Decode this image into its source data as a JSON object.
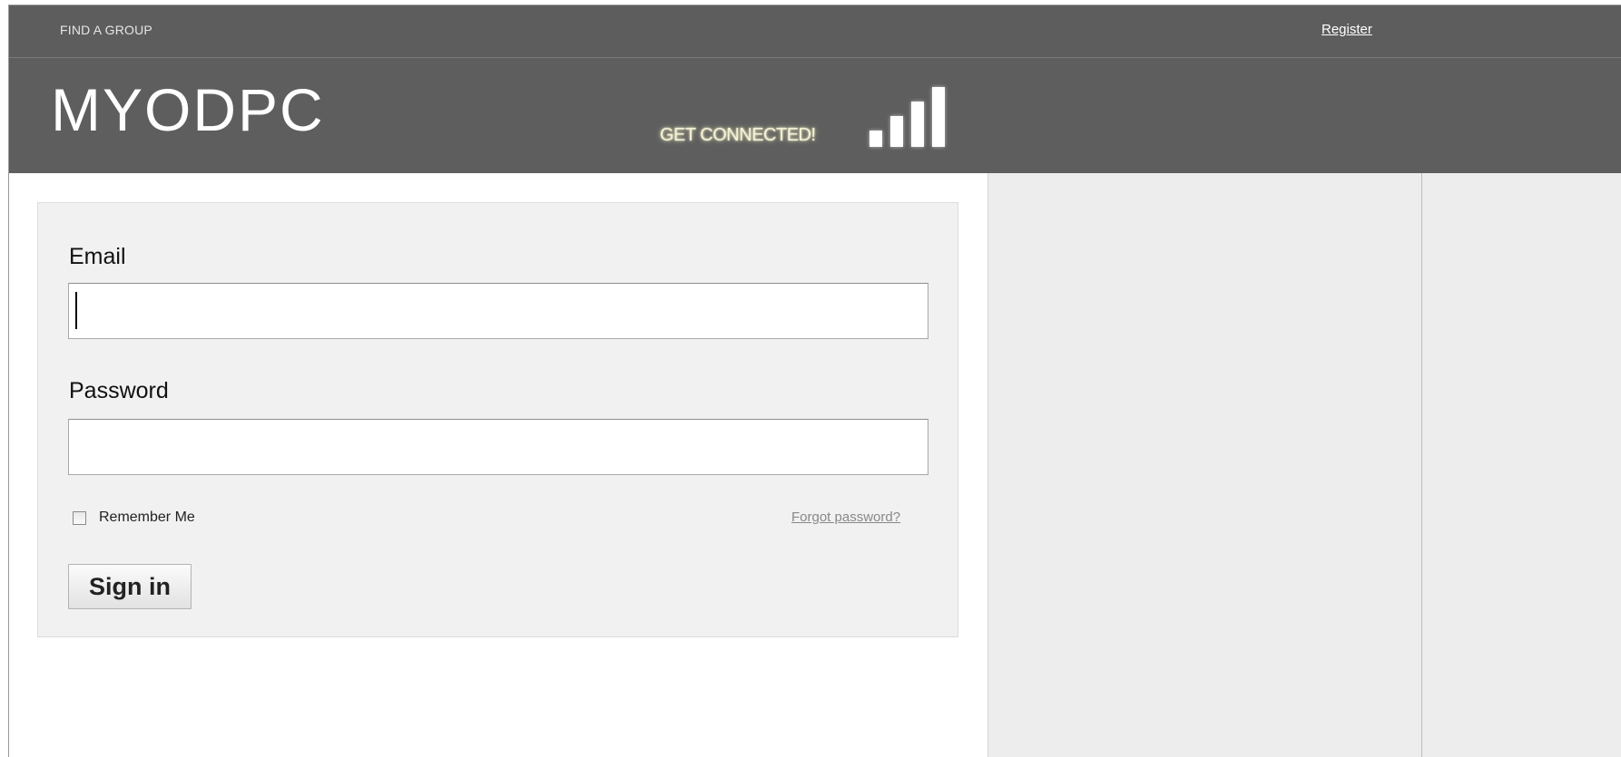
{
  "topbar": {
    "find_group": "FIND A GROUP",
    "register": "Register"
  },
  "header": {
    "logo": "MYODPC",
    "tagline": "GET CONNECTED!",
    "signal_icon": "signal-bars-icon"
  },
  "login": {
    "email_label": "Email",
    "email_value": "",
    "password_label": "Password",
    "password_value": "",
    "remember_label": "Remember Me",
    "remember_checked": false,
    "forgot_label": "Forgot password?",
    "signin_label": "Sign in"
  },
  "colors": {
    "header_bg": "#5e5e5e",
    "panel_bg": "#f1f1f1",
    "sidebar_bg": "#ededed"
  }
}
